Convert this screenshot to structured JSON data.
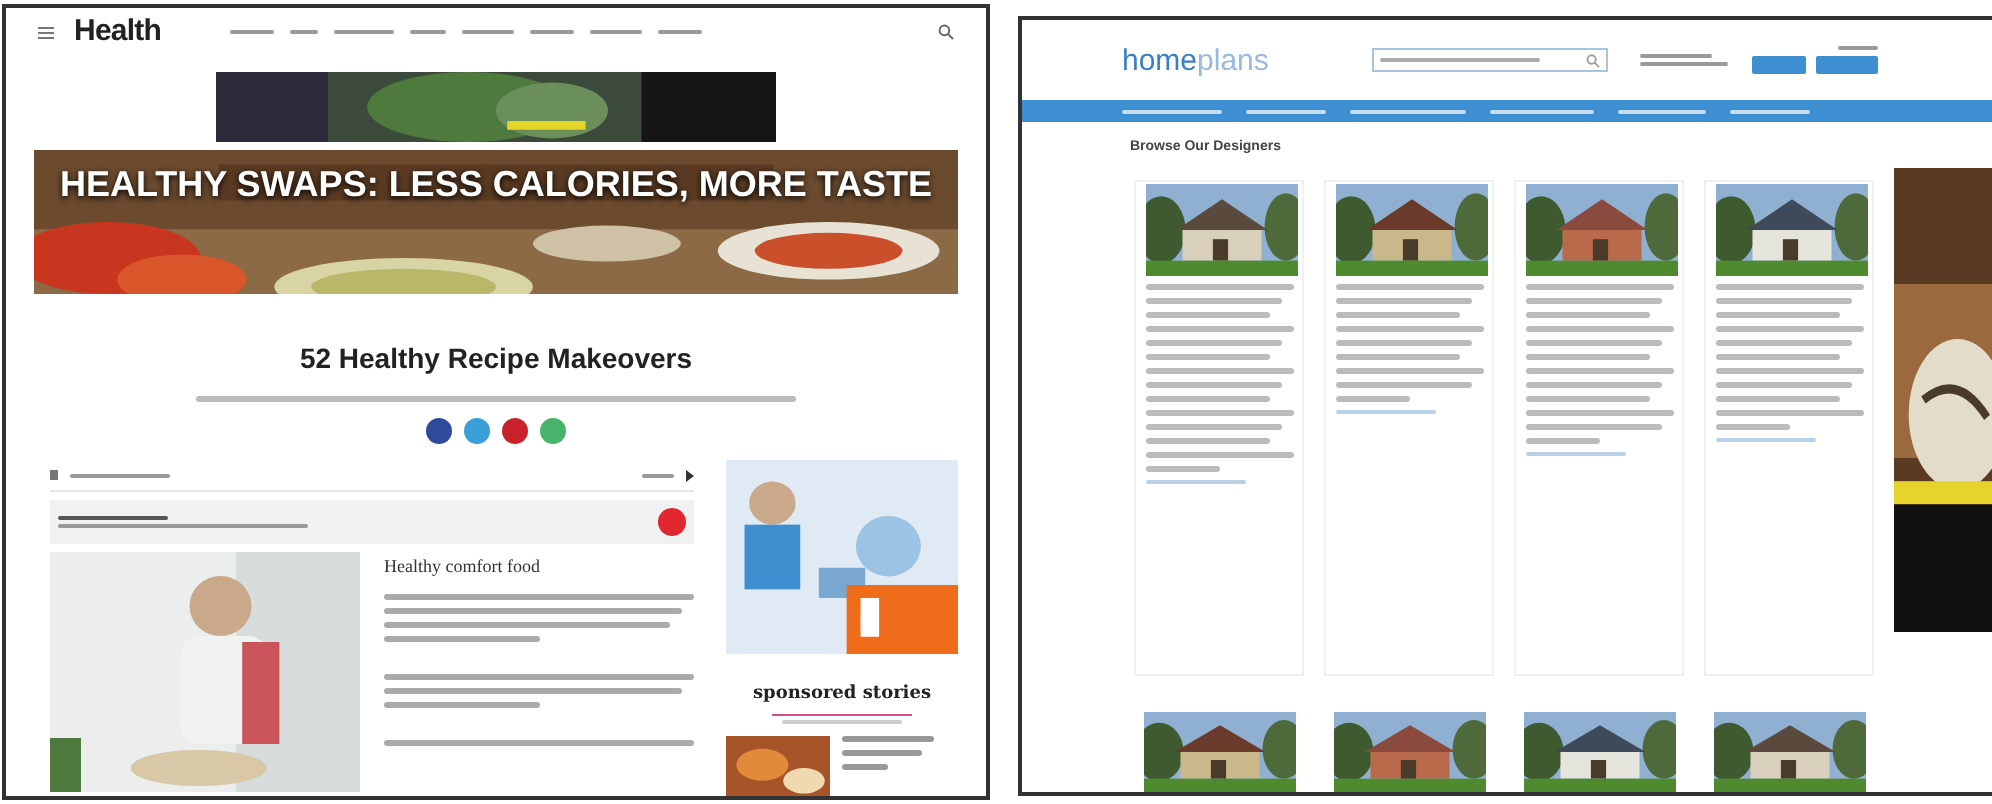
{
  "health": {
    "logo": "Health",
    "hero": {
      "headline": "HEALTHY SWAPS: LESS CALORIES, MORE TASTE"
    },
    "title": "52 Healthy Recipe Makeovers",
    "share_buttons": [
      {
        "color": "#2d4b9a"
      },
      {
        "color": "#3aa0d8"
      },
      {
        "color": "#c8232c"
      },
      {
        "color": "#46b46b"
      }
    ],
    "article": {
      "heading": "Healthy comfort food"
    },
    "sidebar": {
      "heading": "sponsored stories"
    }
  },
  "homeplans": {
    "logo_parts": [
      "home",
      "plans"
    ],
    "section_title": "Browse Our Designers",
    "cards": [
      {
        "kind": "picture"
      },
      {
        "kind": "picture"
      },
      {
        "kind": "picture"
      },
      {
        "kind": "picture"
      }
    ],
    "second_row": [
      {
        "kind": "picture"
      },
      {
        "kind": "picture"
      },
      {
        "kind": "picture"
      },
      {
        "kind": "picture"
      }
    ]
  }
}
